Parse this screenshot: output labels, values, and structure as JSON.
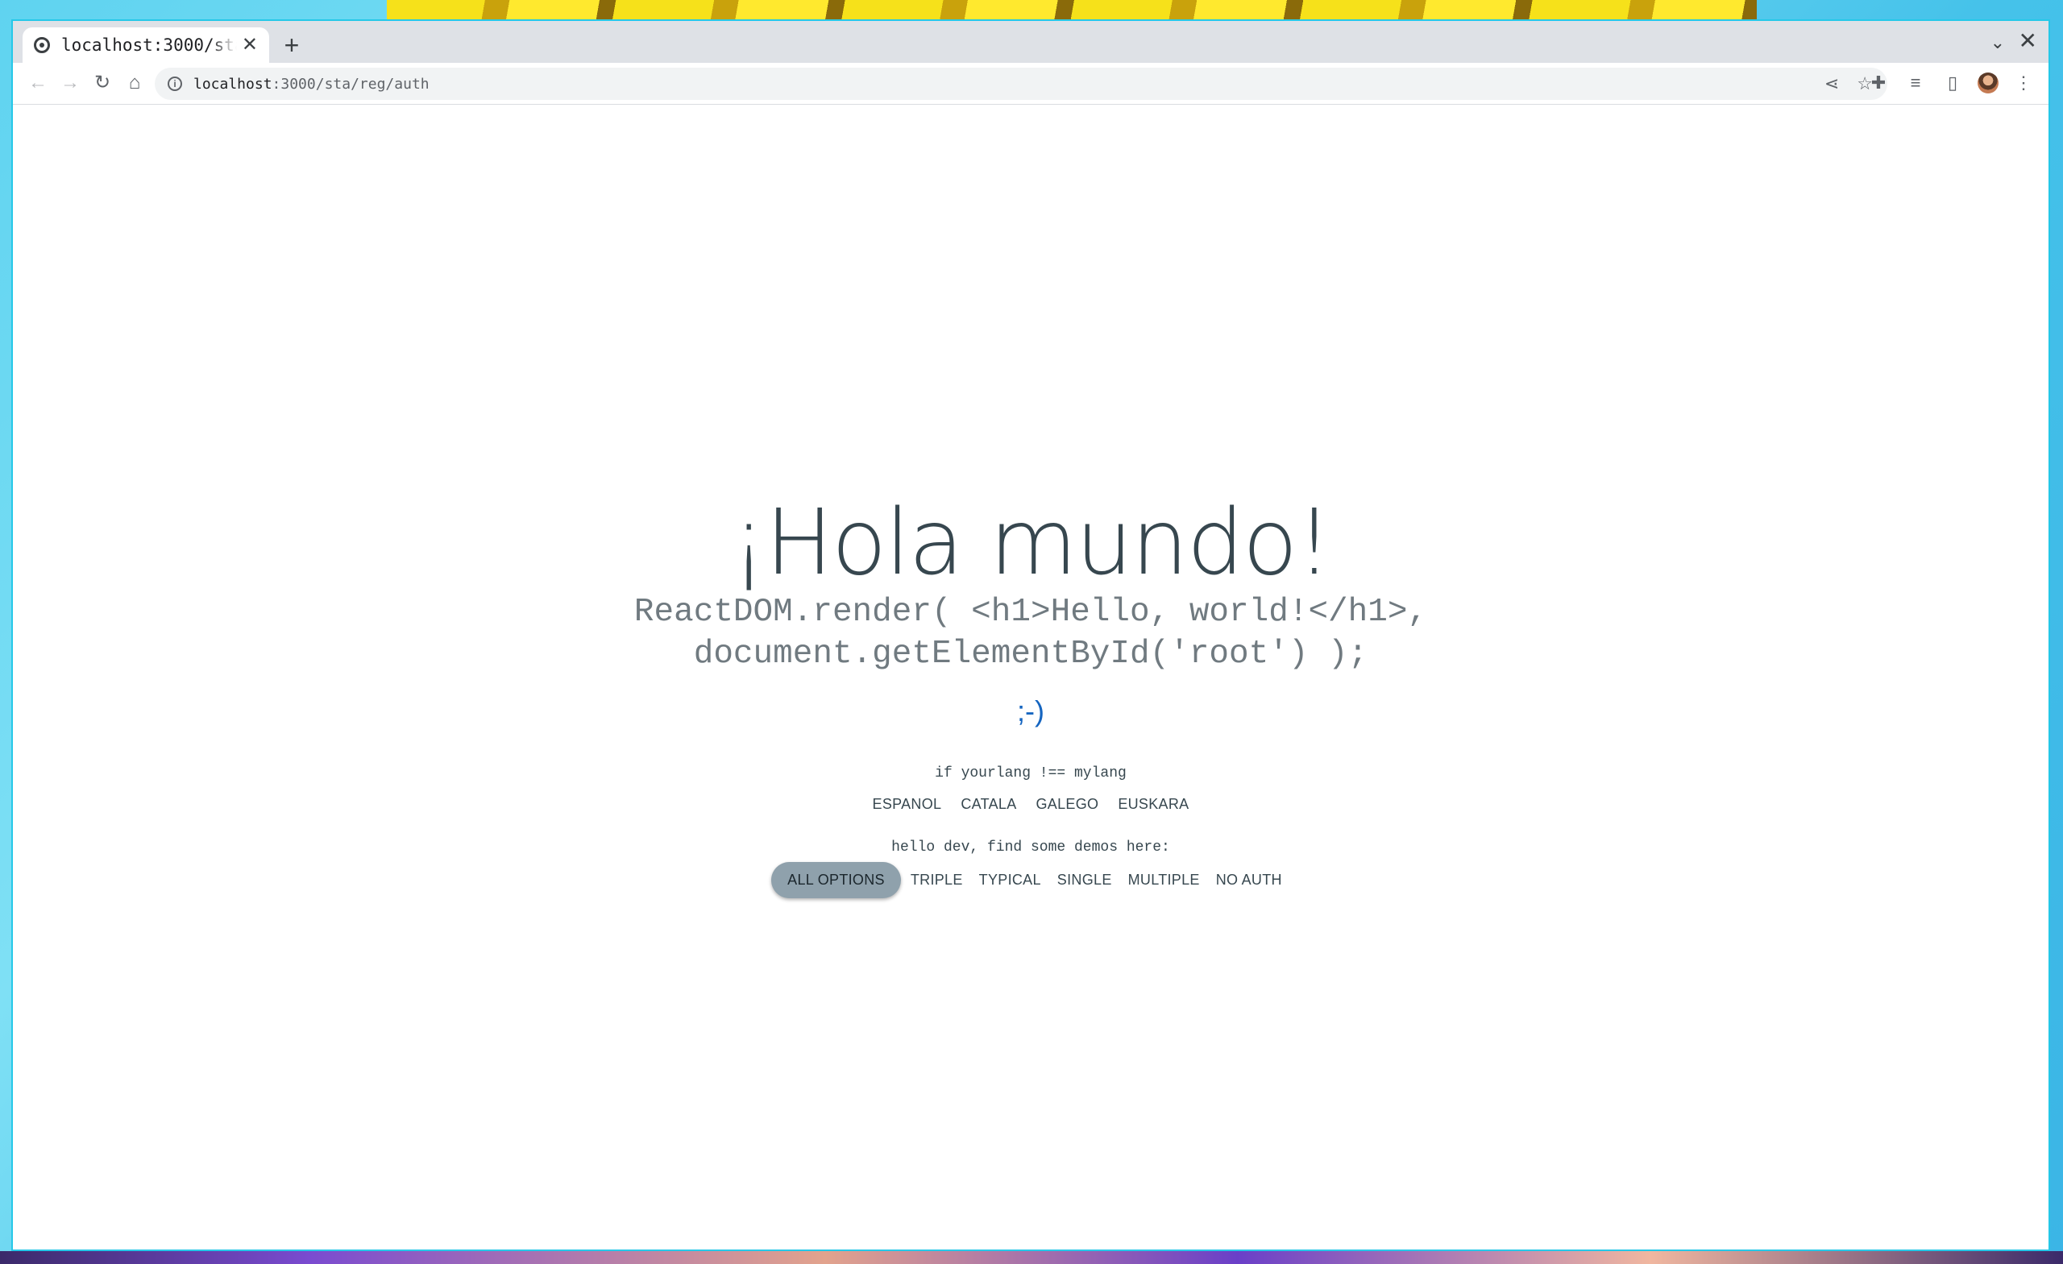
{
  "browser": {
    "tab_title": "localhost:3000/sta",
    "tab_close": "✕",
    "new_tab": "+",
    "url_host": "localhost",
    "url_path": ":3000/sta/reg/auth"
  },
  "icons": {
    "back": "arrow-left-icon",
    "forward": "arrow-right-icon",
    "reload": "reload-icon",
    "home": "home-icon",
    "info": "info-icon",
    "share": "share-icon",
    "bookmark": "star-icon",
    "extensions": "puzzle-icon",
    "media": "media-queue-icon",
    "side_panel": "side-panel-icon",
    "menu": "kebab-menu-icon"
  },
  "page": {
    "heading": "¡Hola mundo!",
    "code_line1": "ReactDOM.render( <h1>Hello, world!</h1>,",
    "code_line2": "document.getElementById('root') );",
    "wink": ";-)",
    "lang_prompt": "if yourlang !== mylang",
    "languages": [
      "ESPANOL",
      "CATALA",
      "GALEGO",
      "EUSKARA"
    ],
    "demo_prompt": "hello dev, find some demos here:",
    "demos": [
      "ALL OPTIONS",
      "TRIPLE",
      "TYPICAL",
      "SINGLE",
      "MULTIPLE",
      "NO AUTH"
    ],
    "active_demo": "ALL OPTIONS"
  },
  "colors": {
    "text": "#37474f",
    "code": "#707a80",
    "wink": "#1565c0",
    "active_button": "#8fa1ac",
    "window_border": "#25c8e8"
  }
}
